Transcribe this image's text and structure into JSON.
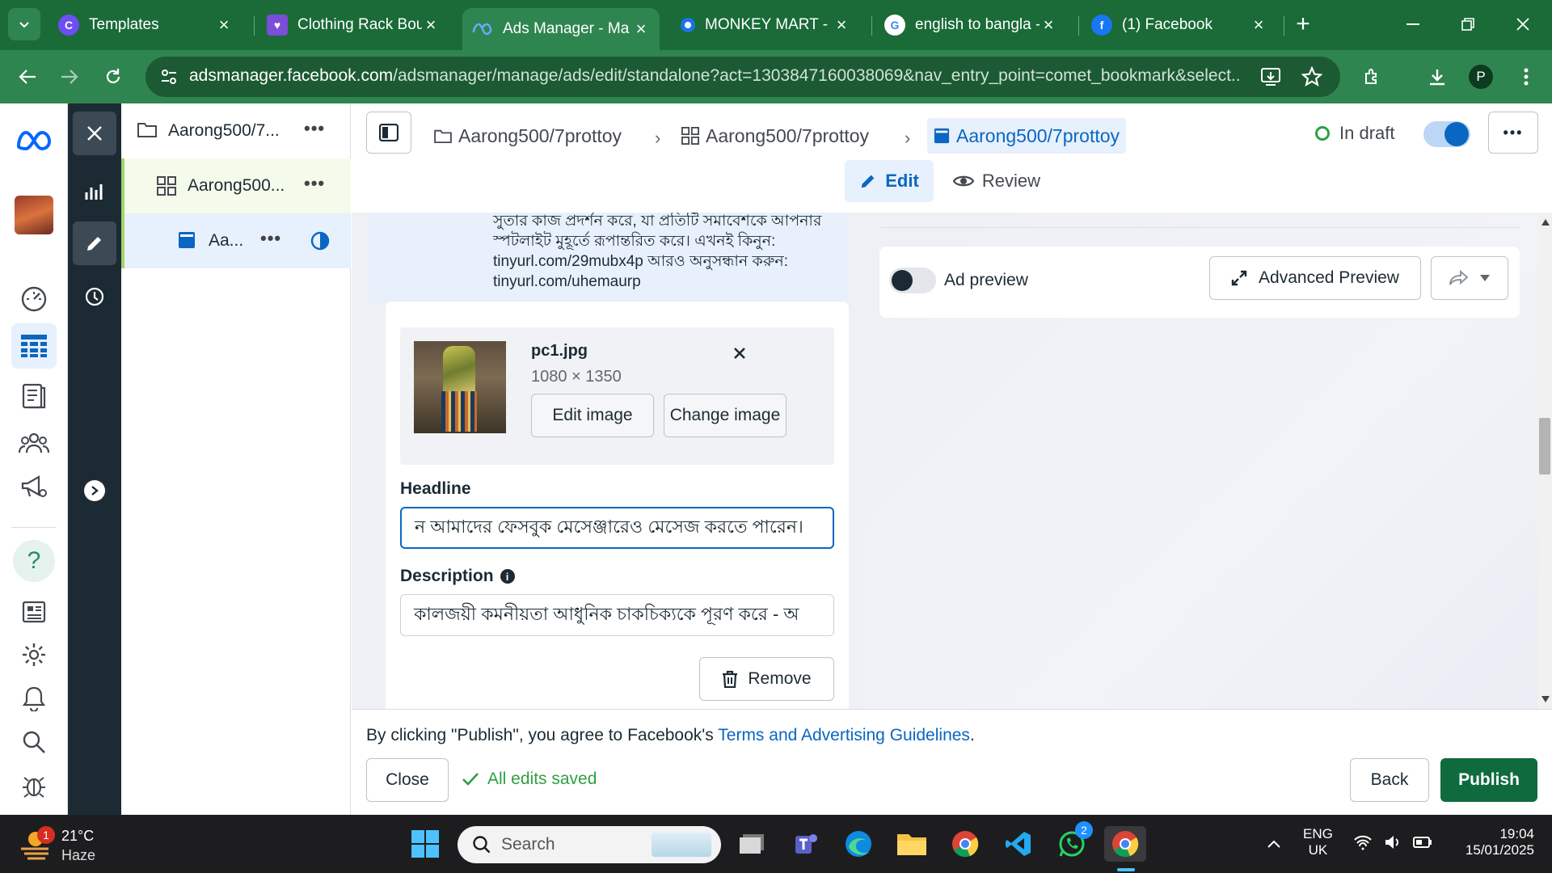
{
  "browser": {
    "tabs": [
      {
        "title": "Templates",
        "active": false
      },
      {
        "title": "Clothing Rack Bou",
        "active": false
      },
      {
        "title": "Ads Manager - Ma",
        "active": true
      },
      {
        "title": "MONKEY MART - F",
        "active": false
      },
      {
        "title": "english to bangla -",
        "active": false
      },
      {
        "title": "(1) Facebook",
        "active": false
      }
    ],
    "url_host": "adsmanager.facebook.com",
    "url_path": "/adsmanager/manage/ads/edit/standalone?act=1303847160038069&nav_entry_point=comet_bookmark&select...",
    "profile_initial": "P"
  },
  "tree": {
    "campaign": "Aarong500/7...",
    "adset": "Aarong500...",
    "ad": "Aa..."
  },
  "toolbar": {
    "crumb_campaign": "Aarong500/7prottoy",
    "crumb_adset": "Aarong500/7prottoy",
    "crumb_ad": "Aarong500/7prottoy",
    "status": "In draft",
    "edit_tab": "Edit",
    "review_tab": "Review"
  },
  "editor": {
    "primary_text_lines": [
      "সুতার কাজ প্রদর্শন করে, যা প্রতিটি সমাবেশকে আপনার",
      "স্পটলাইট মুহূর্তে রূপান্তরিত করে। এখনই কিনুন:",
      "tinyurl.com/29mubx4p আরও অনুসন্ধান করুন:",
      "tinyurl.com/uhemaurp"
    ],
    "image_name": "pc1.jpg",
    "image_dims": "1080 × 1350",
    "edit_image": "Edit image",
    "change_image": "Change image",
    "headline_label": "Headline",
    "headline_value": "ন আমাদের ফেসবুক মেসেঞ্জারেও মেসেজ করতে পারেন।",
    "description_label": "Description",
    "description_value": "কালজয়ী কমনীয়তা আধুনিক চাকচিক্যকে পূরণ করে - অ",
    "remove": "Remove"
  },
  "preview": {
    "ad_preview": "Ad preview",
    "advanced_preview": "Advanced Preview"
  },
  "footer": {
    "agree_text": "By clicking \"Publish\", you agree to Facebook's ",
    "terms_link": "Terms and Advertising Guidelines",
    "period": ".",
    "close": "Close",
    "saved": "All edits saved",
    "back": "Back",
    "publish": "Publish"
  },
  "taskbar": {
    "weather_temp": "21°C",
    "weather_desc": "Haze",
    "weather_badge": "1",
    "search": "Search",
    "whatsapp_badge": "2",
    "lang_1": "ENG",
    "lang_2": "UK",
    "time": "19:04",
    "date": "15/01/2025"
  },
  "colors": {
    "chrome_green": "#1a6b37",
    "accent_blue": "#0a66c2",
    "publish_green": "#0f6b3e"
  }
}
